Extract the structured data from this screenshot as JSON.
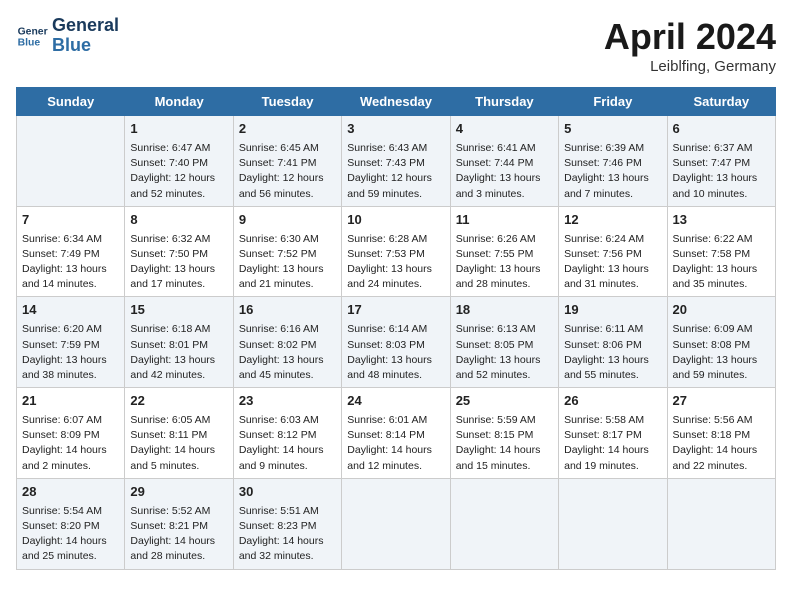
{
  "header": {
    "logo_line1": "General",
    "logo_line2": "Blue",
    "month": "April 2024",
    "location": "Leiblfing, Germany"
  },
  "days_of_week": [
    "Sunday",
    "Monday",
    "Tuesday",
    "Wednesday",
    "Thursday",
    "Friday",
    "Saturday"
  ],
  "weeks": [
    [
      {
        "day": "",
        "info": ""
      },
      {
        "day": "1",
        "info": "Sunrise: 6:47 AM\nSunset: 7:40 PM\nDaylight: 12 hours\nand 52 minutes."
      },
      {
        "day": "2",
        "info": "Sunrise: 6:45 AM\nSunset: 7:41 PM\nDaylight: 12 hours\nand 56 minutes."
      },
      {
        "day": "3",
        "info": "Sunrise: 6:43 AM\nSunset: 7:43 PM\nDaylight: 12 hours\nand 59 minutes."
      },
      {
        "day": "4",
        "info": "Sunrise: 6:41 AM\nSunset: 7:44 PM\nDaylight: 13 hours\nand 3 minutes."
      },
      {
        "day": "5",
        "info": "Sunrise: 6:39 AM\nSunset: 7:46 PM\nDaylight: 13 hours\nand 7 minutes."
      },
      {
        "day": "6",
        "info": "Sunrise: 6:37 AM\nSunset: 7:47 PM\nDaylight: 13 hours\nand 10 minutes."
      }
    ],
    [
      {
        "day": "7",
        "info": "Sunrise: 6:34 AM\nSunset: 7:49 PM\nDaylight: 13 hours\nand 14 minutes."
      },
      {
        "day": "8",
        "info": "Sunrise: 6:32 AM\nSunset: 7:50 PM\nDaylight: 13 hours\nand 17 minutes."
      },
      {
        "day": "9",
        "info": "Sunrise: 6:30 AM\nSunset: 7:52 PM\nDaylight: 13 hours\nand 21 minutes."
      },
      {
        "day": "10",
        "info": "Sunrise: 6:28 AM\nSunset: 7:53 PM\nDaylight: 13 hours\nand 24 minutes."
      },
      {
        "day": "11",
        "info": "Sunrise: 6:26 AM\nSunset: 7:55 PM\nDaylight: 13 hours\nand 28 minutes."
      },
      {
        "day": "12",
        "info": "Sunrise: 6:24 AM\nSunset: 7:56 PM\nDaylight: 13 hours\nand 31 minutes."
      },
      {
        "day": "13",
        "info": "Sunrise: 6:22 AM\nSunset: 7:58 PM\nDaylight: 13 hours\nand 35 minutes."
      }
    ],
    [
      {
        "day": "14",
        "info": "Sunrise: 6:20 AM\nSunset: 7:59 PM\nDaylight: 13 hours\nand 38 minutes."
      },
      {
        "day": "15",
        "info": "Sunrise: 6:18 AM\nSunset: 8:01 PM\nDaylight: 13 hours\nand 42 minutes."
      },
      {
        "day": "16",
        "info": "Sunrise: 6:16 AM\nSunset: 8:02 PM\nDaylight: 13 hours\nand 45 minutes."
      },
      {
        "day": "17",
        "info": "Sunrise: 6:14 AM\nSunset: 8:03 PM\nDaylight: 13 hours\nand 48 minutes."
      },
      {
        "day": "18",
        "info": "Sunrise: 6:13 AM\nSunset: 8:05 PM\nDaylight: 13 hours\nand 52 minutes."
      },
      {
        "day": "19",
        "info": "Sunrise: 6:11 AM\nSunset: 8:06 PM\nDaylight: 13 hours\nand 55 minutes."
      },
      {
        "day": "20",
        "info": "Sunrise: 6:09 AM\nSunset: 8:08 PM\nDaylight: 13 hours\nand 59 minutes."
      }
    ],
    [
      {
        "day": "21",
        "info": "Sunrise: 6:07 AM\nSunset: 8:09 PM\nDaylight: 14 hours\nand 2 minutes."
      },
      {
        "day": "22",
        "info": "Sunrise: 6:05 AM\nSunset: 8:11 PM\nDaylight: 14 hours\nand 5 minutes."
      },
      {
        "day": "23",
        "info": "Sunrise: 6:03 AM\nSunset: 8:12 PM\nDaylight: 14 hours\nand 9 minutes."
      },
      {
        "day": "24",
        "info": "Sunrise: 6:01 AM\nSunset: 8:14 PM\nDaylight: 14 hours\nand 12 minutes."
      },
      {
        "day": "25",
        "info": "Sunrise: 5:59 AM\nSunset: 8:15 PM\nDaylight: 14 hours\nand 15 minutes."
      },
      {
        "day": "26",
        "info": "Sunrise: 5:58 AM\nSunset: 8:17 PM\nDaylight: 14 hours\nand 19 minutes."
      },
      {
        "day": "27",
        "info": "Sunrise: 5:56 AM\nSunset: 8:18 PM\nDaylight: 14 hours\nand 22 minutes."
      }
    ],
    [
      {
        "day": "28",
        "info": "Sunrise: 5:54 AM\nSunset: 8:20 PM\nDaylight: 14 hours\nand 25 minutes."
      },
      {
        "day": "29",
        "info": "Sunrise: 5:52 AM\nSunset: 8:21 PM\nDaylight: 14 hours\nand 28 minutes."
      },
      {
        "day": "30",
        "info": "Sunrise: 5:51 AM\nSunset: 8:23 PM\nDaylight: 14 hours\nand 32 minutes."
      },
      {
        "day": "",
        "info": ""
      },
      {
        "day": "",
        "info": ""
      },
      {
        "day": "",
        "info": ""
      },
      {
        "day": "",
        "info": ""
      }
    ]
  ]
}
